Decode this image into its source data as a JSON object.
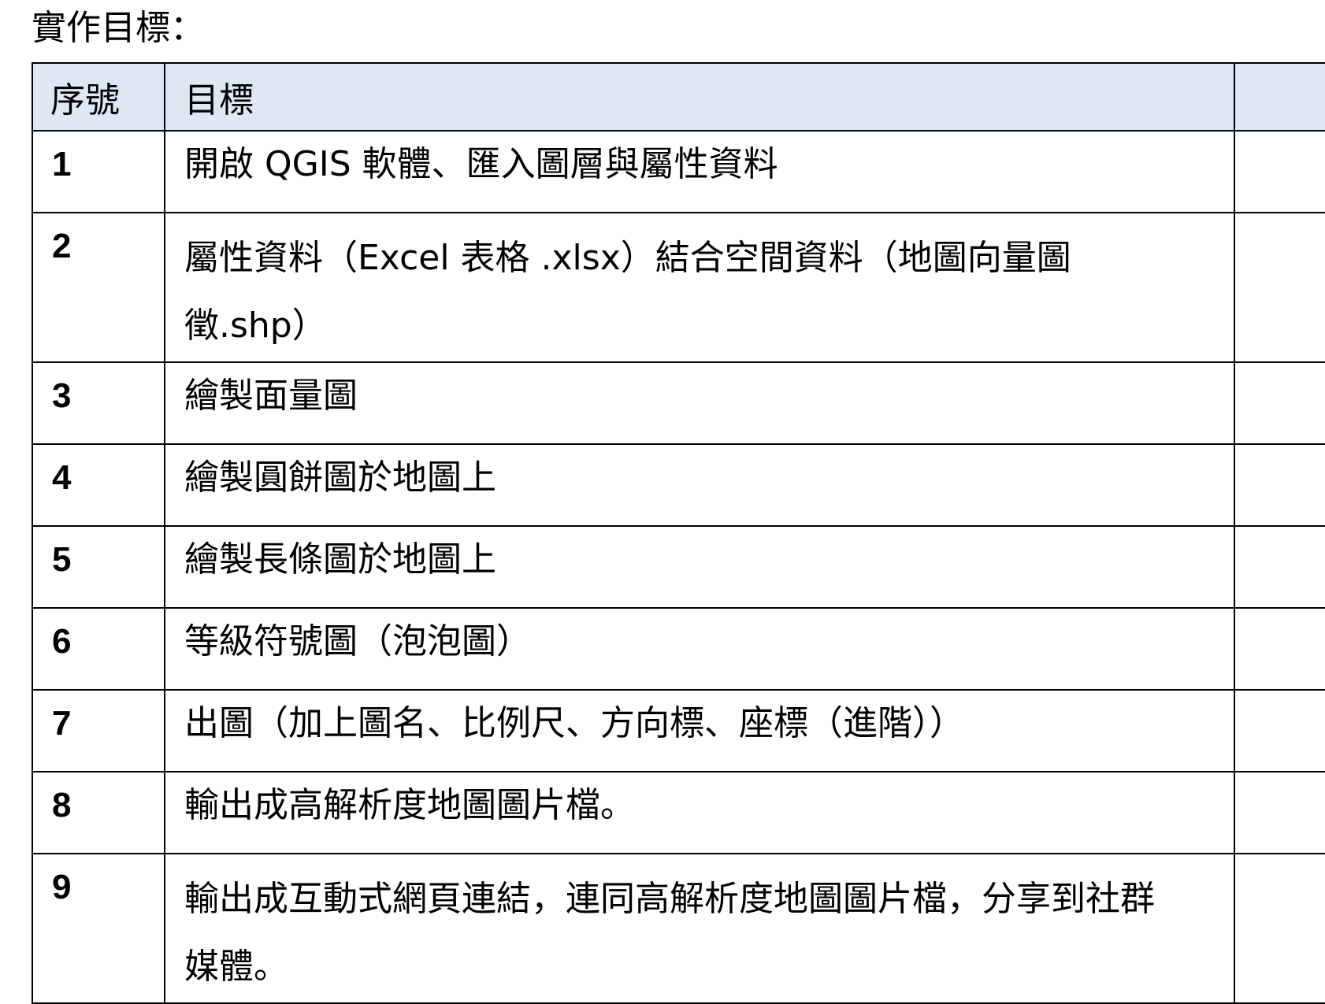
{
  "heading": "實作目標：",
  "table": {
    "headers": [
      "序號",
      "目標"
    ],
    "rows": [
      {
        "no": "1",
        "goal": "開啟 QGIS 軟體、匯入圖層與屬性資料"
      },
      {
        "no": "2",
        "goal": "屬性資料（Excel 表格 .xlsx）結合空間資料（地圖向量圖徵.shp）"
      },
      {
        "no": "3",
        "goal": "繪製面量圖"
      },
      {
        "no": "4",
        "goal": "繪製圓餅圖於地圖上"
      },
      {
        "no": "5",
        "goal": "繪製長條圖於地圖上"
      },
      {
        "no": "6",
        "goal": "等級符號圖（泡泡圖）"
      },
      {
        "no": "7",
        "goal": "出圖（加上圖名、比例尺、方向標、座標（進階））"
      },
      {
        "no": "8",
        "goal": "輸出成高解析度地圖圖片檔。"
      },
      {
        "no": "9",
        "goal": "輸出成互動式網頁連結，連同高解析度地圖圖片檔，分享到社群媒體。"
      }
    ]
  }
}
